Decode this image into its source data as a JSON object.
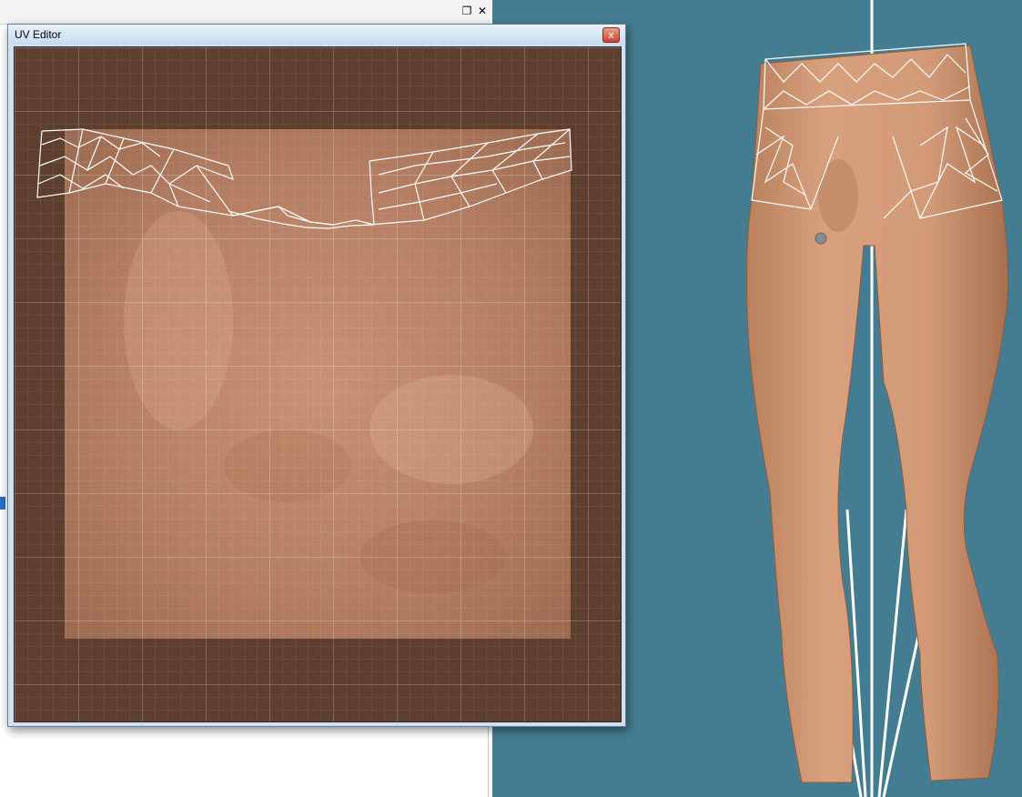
{
  "top_bar": {
    "restore_icon": "❐",
    "close_icon": "✕"
  },
  "uv_editor": {
    "title": "UV Editor",
    "close_glyph": "x"
  },
  "colors": {
    "viewport_bg": "#447c92",
    "uv_bg": "#5a3b2c",
    "skin": "#d29a78",
    "wire": "#ffffff"
  }
}
